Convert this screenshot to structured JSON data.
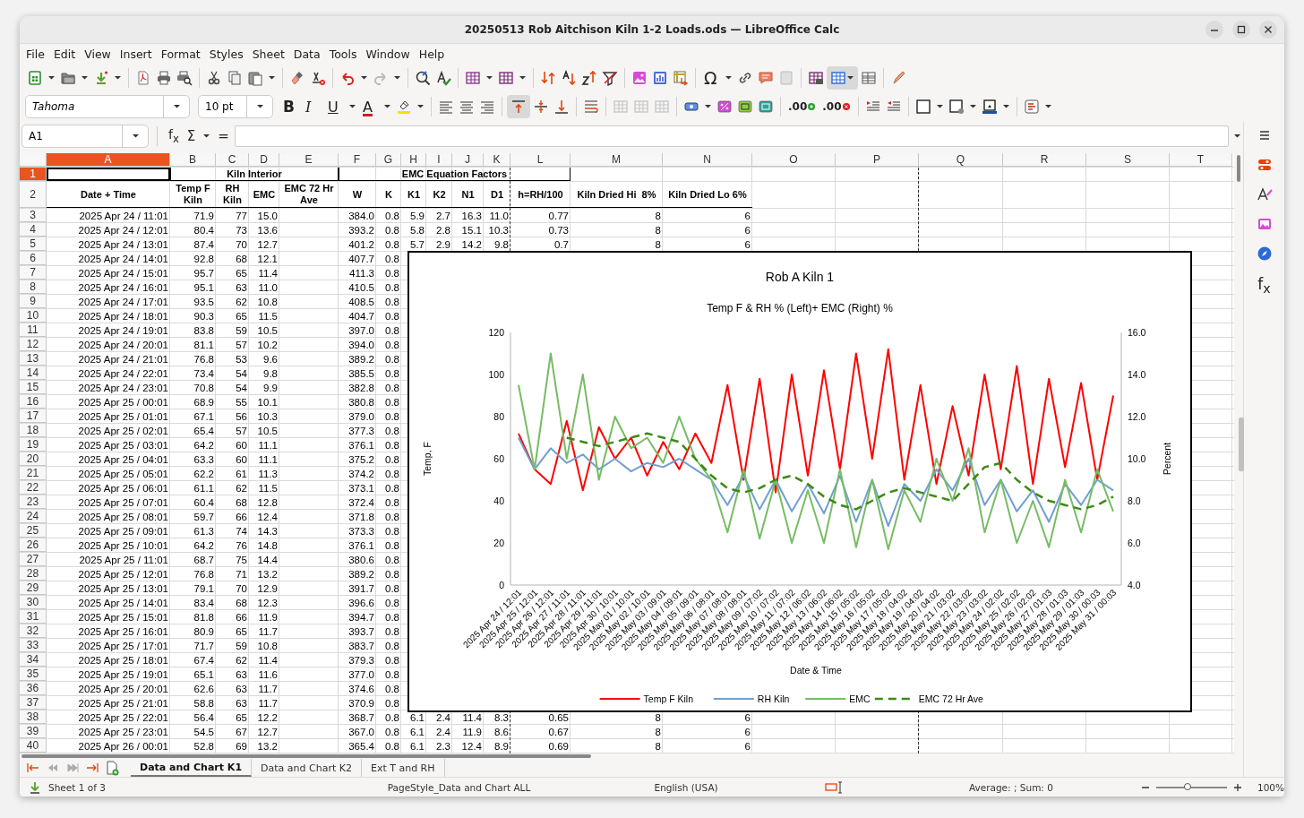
{
  "window": {
    "title": "20250513 Rob Aitchison Kiln 1-2 Loads.ods — LibreOffice Calc"
  },
  "menu": [
    "File",
    "Edit",
    "View",
    "Insert",
    "Format",
    "Styles",
    "Sheet",
    "Data",
    "Tools",
    "Window",
    "Help"
  ],
  "toolbar": {
    "special_character": "Ω",
    "freeze_on": true
  },
  "formatting": {
    "font": "Tahoma",
    "size": "10 pt",
    "bold": "B",
    "italic": "I",
    "underline": "U",
    "font_color": "A",
    "align_top_on": true,
    "add_decimal": ".00",
    "remove_decimal": ".00"
  },
  "formula_bar": {
    "name_box": "A1",
    "function_wizard": "f$_{x}$",
    "sum": "Σ",
    "equals": "="
  },
  "columns": [
    {
      "label": "A",
      "selected": true
    },
    {
      "label": "B",
      "selected": false
    },
    {
      "label": "C",
      "selected": false
    },
    {
      "label": "D",
      "selected": false
    },
    {
      "label": "E",
      "selected": false
    },
    {
      "label": "F",
      "selected": false
    },
    {
      "label": "G",
      "selected": false
    },
    {
      "label": "H",
      "selected": false
    },
    {
      "label": "I",
      "selected": false
    },
    {
      "label": "J",
      "selected": false
    },
    {
      "label": "K",
      "selected": false
    },
    {
      "label": "L",
      "selected": false
    },
    {
      "label": "M",
      "selected": false
    },
    {
      "label": "N",
      "selected": false
    },
    {
      "label": "O",
      "selected": false
    },
    {
      "label": "P",
      "selected": false
    },
    {
      "label": "Q",
      "selected": false
    },
    {
      "label": "R",
      "selected": false
    },
    {
      "label": "S",
      "selected": false
    },
    {
      "label": "T",
      "selected": false
    }
  ],
  "title_row": {
    "number": "1",
    "selected": true,
    "groups": [
      {
        "label": "Kiln Interior"
      },
      {
        "label": "EMC Equation Factors"
      }
    ]
  },
  "header_row": {
    "number": "2",
    "selected": false,
    "cells": [
      "Date + Time",
      "Temp F Kiln",
      "RH Kiln",
      "EMC",
      "EMC 72 Hr Ave",
      "W",
      "K",
      "K1",
      "K2",
      "N1",
      "D1",
      "h=RH/100",
      "Kiln Dried Hi  8%",
      "Kiln Dried Lo 6%"
    ]
  },
  "rows": [
    {
      "number": "3",
      "selected": false,
      "cells": [
        "2025 Apr 24 / 11:01",
        "71.9",
        "77",
        "15.0",
        null,
        "384.0",
        "0.8",
        "5.9",
        "2.7",
        "16.3",
        "11.0",
        "0.77",
        "8",
        "6"
      ]
    },
    {
      "number": "4",
      "selected": false,
      "cells": [
        "2025 Apr 24 / 12:01",
        "80.4",
        "73",
        "13.6",
        null,
        "393.2",
        "0.8",
        "5.8",
        "2.8",
        "15.1",
        "10.3",
        "0.73",
        "8",
        "6"
      ]
    },
    {
      "number": "5",
      "selected": false,
      "cells": [
        "2025 Apr 24 / 13:01",
        "87.4",
        "70",
        "12.7",
        null,
        "401.2",
        "0.8",
        "5.7",
        "2.9",
        "14.2",
        "9.8",
        "0.7",
        "8",
        "6"
      ]
    },
    {
      "number": "6",
      "selected": false,
      "cells": [
        "2025 Apr 24 / 14:01",
        "92.8",
        "68",
        "12.1",
        null,
        "407.7",
        "0.8"
      ]
    },
    {
      "number": "7",
      "selected": false,
      "cells": [
        "2025 Apr 24 / 15:01",
        "95.7",
        "65",
        "11.4",
        null,
        "411.3",
        "0.8"
      ]
    },
    {
      "number": "8",
      "selected": false,
      "cells": [
        "2025 Apr 24 / 16:01",
        "95.1",
        "63",
        "11.0",
        null,
        "410.5",
        "0.8"
      ]
    },
    {
      "number": "9",
      "selected": false,
      "cells": [
        "2025 Apr 24 / 17:01",
        "93.5",
        "62",
        "10.8",
        null,
        "408.5",
        "0.8"
      ]
    },
    {
      "number": "10",
      "selected": false,
      "cells": [
        "2025 Apr 24 / 18:01",
        "90.3",
        "65",
        "11.5",
        null,
        "404.7",
        "0.8"
      ]
    },
    {
      "number": "11",
      "selected": false,
      "cells": [
        "2025 Apr 24 / 19:01",
        "83.8",
        "59",
        "10.5",
        null,
        "397.0",
        "0.8"
      ]
    },
    {
      "number": "12",
      "selected": false,
      "cells": [
        "2025 Apr 24 / 20:01",
        "81.1",
        "57",
        "10.2",
        null,
        "394.0",
        "0.8"
      ]
    },
    {
      "number": "13",
      "selected": false,
      "cells": [
        "2025 Apr 24 / 21:01",
        "76.8",
        "53",
        "9.6",
        null,
        "389.2",
        "0.8"
      ]
    },
    {
      "number": "14",
      "selected": false,
      "cells": [
        "2025 Apr 24 / 22:01",
        "73.4",
        "54",
        "9.8",
        null,
        "385.5",
        "0.8"
      ]
    },
    {
      "number": "15",
      "selected": false,
      "cells": [
        "2025 Apr 24 / 23:01",
        "70.8",
        "54",
        "9.9",
        null,
        "382.8",
        "0.8"
      ]
    },
    {
      "number": "16",
      "selected": false,
      "cells": [
        "2025 Apr 25 / 00:01",
        "68.9",
        "55",
        "10.1",
        null,
        "380.8",
        "0.8"
      ]
    },
    {
      "number": "17",
      "selected": false,
      "cells": [
        "2025 Apr 25 / 01:01",
        "67.1",
        "56",
        "10.3",
        null,
        "379.0",
        "0.8"
      ]
    },
    {
      "number": "18",
      "selected": false,
      "cells": [
        "2025 Apr 25 / 02:01",
        "65.4",
        "57",
        "10.5",
        null,
        "377.3",
        "0.8"
      ]
    },
    {
      "number": "19",
      "selected": false,
      "cells": [
        "2025 Apr 25 / 03:01",
        "64.2",
        "60",
        "11.1",
        null,
        "376.1",
        "0.8"
      ]
    },
    {
      "number": "20",
      "selected": false,
      "cells": [
        "2025 Apr 25 / 04:01",
        "63.3",
        "60",
        "11.1",
        null,
        "375.2",
        "0.8"
      ]
    },
    {
      "number": "21",
      "selected": false,
      "cells": [
        "2025 Apr 25 / 05:01",
        "62.2",
        "61",
        "11.3",
        null,
        "374.2",
        "0.8"
      ]
    },
    {
      "number": "22",
      "selected": false,
      "cells": [
        "2025 Apr 25 / 06:01",
        "61.1",
        "62",
        "11.5",
        null,
        "373.1",
        "0.8"
      ]
    },
    {
      "number": "23",
      "selected": false,
      "cells": [
        "2025 Apr 25 / 07:01",
        "60.4",
        "68",
        "12.8",
        null,
        "372.4",
        "0.8"
      ]
    },
    {
      "number": "24",
      "selected": false,
      "cells": [
        "2025 Apr 25 / 08:01",
        "59.7",
        "66",
        "12.4",
        null,
        "371.8",
        "0.8"
      ]
    },
    {
      "number": "25",
      "selected": false,
      "cells": [
        "2025 Apr 25 / 09:01",
        "61.3",
        "74",
        "14.3",
        null,
        "373.3",
        "0.8"
      ]
    },
    {
      "number": "26",
      "selected": false,
      "cells": [
        "2025 Apr 25 / 10:01",
        "64.2",
        "76",
        "14.8",
        null,
        "376.1",
        "0.8"
      ]
    },
    {
      "number": "27",
      "selected": false,
      "cells": [
        "2025 Apr 25 / 11:01",
        "68.7",
        "75",
        "14.4",
        null,
        "380.6",
        "0.8"
      ]
    },
    {
      "number": "28",
      "selected": false,
      "cells": [
        "2025 Apr 25 / 12:01",
        "76.8",
        "71",
        "13.2",
        null,
        "389.2",
        "0.8"
      ]
    },
    {
      "number": "29",
      "selected": false,
      "cells": [
        "2025 Apr 25 / 13:01",
        "79.1",
        "70",
        "12.9",
        null,
        "391.7",
        "0.8"
      ]
    },
    {
      "number": "30",
      "selected": false,
      "cells": [
        "2025 Apr 25 / 14:01",
        "83.4",
        "68",
        "12.3",
        null,
        "396.6",
        "0.8"
      ]
    },
    {
      "number": "31",
      "selected": false,
      "cells": [
        "2025 Apr 25 / 15:01",
        "81.8",
        "66",
        "11.9",
        null,
        "394.7",
        "0.8"
      ]
    },
    {
      "number": "32",
      "selected": false,
      "cells": [
        "2025 Apr 25 / 16:01",
        "80.9",
        "65",
        "11.7",
        null,
        "393.7",
        "0.8"
      ]
    },
    {
      "number": "33",
      "selected": false,
      "cells": [
        "2025 Apr 25 / 17:01",
        "71.7",
        "59",
        "10.8",
        null,
        "383.7",
        "0.8"
      ]
    },
    {
      "number": "34",
      "selected": false,
      "cells": [
        "2025 Apr 25 / 18:01",
        "67.4",
        "62",
        "11.4",
        null,
        "379.3",
        "0.8"
      ]
    },
    {
      "number": "35",
      "selected": false,
      "cells": [
        "2025 Apr 25 / 19:01",
        "65.1",
        "63",
        "11.6",
        null,
        "377.0",
        "0.8"
      ]
    },
    {
      "number": "36",
      "selected": false,
      "cells": [
        "2025 Apr 25 / 20:01",
        "62.6",
        "63",
        "11.7",
        null,
        "374.6",
        "0.8"
      ]
    },
    {
      "number": "37",
      "selected": false,
      "cells": [
        "2025 Apr 25 / 21:01",
        "58.8",
        "63",
        "11.7",
        null,
        "370.9",
        "0.8"
      ]
    },
    {
      "number": "38",
      "selected": false,
      "cells": [
        "2025 Apr 25 / 22:01",
        "56.4",
        "65",
        "12.2",
        null,
        "368.7",
        "0.8",
        "6.1",
        "2.4",
        "11.4",
        "8.3",
        "0.65",
        "8",
        "6"
      ]
    },
    {
      "number": "39",
      "selected": false,
      "cells": [
        "2025 Apr 25 / 23:01",
        "54.5",
        "67",
        "12.7",
        null,
        "367.0",
        "0.8",
        "6.1",
        "2.4",
        "11.9",
        "8.6",
        "0.67",
        "8",
        "6"
      ]
    },
    {
      "number": "40",
      "selected": false,
      "cells": [
        "2025 Apr 26 / 00:01",
        "52.8",
        "69",
        "13.2",
        null,
        "365.4",
        "0.8",
        "6.1",
        "2.3",
        "12.4",
        "8.9",
        "0.69",
        "8",
        "6"
      ]
    }
  ],
  "chart": {
    "chart_data": {
      "type": "line",
      "title": "Rob A Kiln 1",
      "subtitle": "Temp F & RH % (Left)+ EMC (Right) %",
      "xlabel": "Date & Time",
      "ylabel": "Temp, F",
      "y2label": "Percent",
      "categories": [
        "2025 Apr 24 / 12:01",
        "2025 Apr 25 / 12:01",
        "2025 Apr 26 / 12:01",
        "2025 Apr 27 / 11:01",
        "2025 Apr 28 / 11:01",
        "2025 Apr 29 / 11:01",
        "2025 Apr 30 / 10:01",
        "2025 May 01 / 10:01",
        "2025 May 02 / 10:01",
        "2025 May 03 / 09:01",
        "2025 May 04 / 09:01",
        "2025 May 05 / 09:01",
        "2025 May 06 / 08:01",
        "2025 May 07 / 08:01",
        "2025 May 08 / 08:01",
        "2025 May 09 / 07:02",
        "2025 May 10 / 07:02",
        "2025 May 11 / 07:02",
        "2025 May 12 / 06:02",
        "2025 May 13 / 06:02",
        "2025 May 14 / 06:02",
        "2025 May 15 / 05:02",
        "2025 May 16 / 05:02",
        "2025 May 17 / 05:02",
        "2025 May 18 / 04:02",
        "2025 May 19 / 04:02",
        "2025 May 20 / 04:02",
        "2025 May 21 / 03:02",
        "2025 May 22 / 03:02",
        "2025 May 23 / 03:02",
        "2025 May 24 / 02:02",
        "2025 May 25 / 02:02",
        "2025 May 26 / 02:02",
        "2025 May 27 / 01:03",
        "2025 May 28 / 01:03",
        "2025 May 29 / 01:03",
        "2025 May 30 / 00:03",
        "2025 May 31 / 00:03"
      ],
      "series": [
        {
          "name": "Temp F Kiln",
          "color": "#ff0000",
          "line_style": "solid",
          "values": [
            72,
            55,
            48,
            78,
            45,
            75,
            60,
            70,
            52,
            68,
            55,
            72,
            58,
            95,
            50,
            98,
            44,
            100,
            52,
            102,
            55,
            110,
            60,
            112,
            50,
            95,
            48,
            85,
            52,
            100,
            55,
            104,
            48,
            98,
            56,
            96,
            50,
            90
          ]
        },
        {
          "name": "RH Kiln",
          "color": "#729fcf",
          "line_style": "solid",
          "values": [
            70,
            55,
            65,
            58,
            62,
            55,
            60,
            54,
            58,
            56,
            60,
            55,
            50,
            38,
            52,
            36,
            50,
            35,
            48,
            34,
            52,
            30,
            50,
            28,
            48,
            40,
            55,
            45,
            60,
            38,
            50,
            35,
            45,
            30,
            48,
            38,
            50,
            45
          ]
        },
        {
          "name": "EMC",
          "color": "#77bc65",
          "axis": "y2",
          "line_style": "solid",
          "values": [
            13.5,
            9.5,
            15,
            10,
            14,
            9,
            12,
            10.5,
            11,
            9.8,
            12,
            10,
            9,
            6.5,
            9.5,
            6.2,
            9,
            6,
            8.5,
            6,
            9.5,
            5.8,
            9,
            5.7,
            8.5,
            7,
            10,
            8,
            10.5,
            6.5,
            9,
            6,
            8,
            5.8,
            9,
            6.5,
            9.5,
            7.5
          ]
        },
        {
          "name": "EMC 72 Hr Ave",
          "color": "#3c8a12",
          "axis": "y2",
          "line_style": "dashed",
          "values": [
            null,
            null,
            null,
            11,
            10.8,
            10.6,
            10.8,
            11,
            11.2,
            11,
            10.8,
            10,
            9.2,
            8.6,
            8.4,
            8.6,
            9,
            9.2,
            8.8,
            8.2,
            7.8,
            7.6,
            8,
            8.4,
            8.6,
            8.4,
            8.2,
            8,
            8.8,
            9.6,
            9.8,
            9,
            8.4,
            8,
            7.8,
            7.6,
            7.8,
            8.2
          ]
        }
      ],
      "legend": "bottom",
      "ylim": [
        0,
        120
      ],
      "yticks": [
        0,
        20,
        40,
        60,
        80,
        100,
        120
      ],
      "y2lim": [
        4,
        16
      ],
      "y2ticks": [
        {
          "value": 4,
          "label": "4.0"
        },
        {
          "value": 6,
          "label": "6.0"
        },
        {
          "value": 8,
          "label": "8.0"
        },
        {
          "value": 10,
          "label": "10.0"
        },
        {
          "value": 12,
          "label": "12.0"
        },
        {
          "value": 14,
          "label": "14.0"
        },
        {
          "value": 16,
          "label": "16.0"
        }
      ]
    }
  },
  "sheet_tabs": [
    {
      "label": "Data and Chart K1",
      "selected": true
    },
    {
      "label": "Data and Chart K2",
      "selected": false
    },
    {
      "label": "Ext T and RH",
      "selected": false
    }
  ],
  "sidebar": {
    "function_glyph": "f$_{x}$"
  },
  "status_bar": {
    "sheet": "Sheet 1 of 3",
    "page_style": "PageStyle_Data and Chart ALL",
    "language": "English (USA)",
    "selection": "Average: ; Sum: 0",
    "zoom": "100%",
    "zoom_slider": {
      "level": 0.45
    }
  }
}
